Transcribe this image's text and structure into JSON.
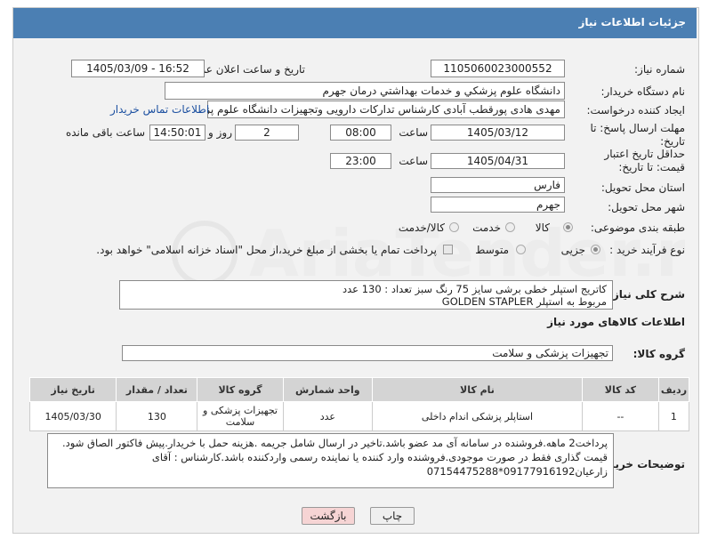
{
  "header": {
    "title": "جزئیات اطلاعات نیاز"
  },
  "form": {
    "need_number_label": "شماره نیاز:",
    "need_number": "1105060023000552",
    "announce_label": "تاریخ و ساعت اعلان عمومی:",
    "announce_value": "1405/03/09 - 16:52",
    "buyer_org_label": "نام دستگاه خریدار:",
    "buyer_org": "دانشگاه علوم پزشکي و خدمات بهداشتي  درمان جهرم",
    "creator_label": "ایجاد کننده درخواست:",
    "creator": "مهدی هادی پورقطب آبادی کارشناس تدارکات دارویی وتجهیزات دانشگاه علوم پز",
    "contact_link": "اطلاعات تماس خریدار",
    "deadline_label": "مهلت ارسال پاسخ: تا تاریخ:",
    "deadline_date": "1405/03/12",
    "time_label": "ساعت",
    "deadline_time": "08:00",
    "days_value": "2",
    "days_label": "روز و",
    "remaining_time": "14:50:01",
    "remaining_label": "ساعت باقی مانده",
    "validity_label": "حداقل تاریخ اعتبار قیمت: تا تاریخ:",
    "validity_date": "1405/04/31",
    "validity_time": "23:00",
    "province_label": "استان محل تحویل:",
    "province": "فارس",
    "city_label": "شهر محل تحویل:",
    "city": "جهرم",
    "category_label": "طبقه بندی موضوعی:",
    "category_options": [
      "کالا",
      "خدمت",
      "کالا/خدمت"
    ],
    "process_label": "نوع فرآیند خرید :",
    "process_options": [
      "جزیی",
      "متوسط"
    ],
    "payment_note": "پرداخت تمام یا بخشی از مبلغ خرید،از محل \"اسناد خزانه اسلامی\" خواهد بود."
  },
  "summary": {
    "label": "شرح کلی نیاز:",
    "line1": "کاتریج استپلر خطی برشی سایز 75 رنگ  سبز    تعداد : 130 عدد",
    "line2": "مربوط به استپلر  GOLDEN STAPLER"
  },
  "goods": {
    "section_title": "اطلاعات کالاهای مورد نیاز",
    "group_label": "گروه کالا:",
    "group_value": "تجهیزات پزشکی و سلامت",
    "columns": [
      "ردیف",
      "کد کالا",
      "نام کالا",
      "واحد شمارش",
      "گروه کالا",
      "تعداد / مقدار",
      "تاریخ نیاز"
    ],
    "rows": [
      [
        "1",
        "--",
        "استاپلر پزشکی اندام داخلی",
        "عدد",
        "تجهیزات پزشکی و سلامت",
        "130",
        "1405/03/30"
      ]
    ]
  },
  "buyer_notes": {
    "label": "توضیحات خریدار:",
    "text": "پرداخت2 ماهه.فروشنده در سامانه آی مد عضو باشد.تاخیر در ارسال شامل جریمه .هزینه حمل با خریدار.پیش فاکتور الصاق شود. قیمت گذاری فقط در صورت موجودی.فروشنده وارد کننده یا نماینده رسمی واردکننده باشد.کارشناس : آقای زارعیان09177916192*07154475288"
  },
  "buttons": {
    "print": "چاپ",
    "back": "بازگشت"
  },
  "colors": {
    "title_bar": "#4b7fb3",
    "table_header": "#d4d4d4",
    "back_button": "#f6d4d4"
  }
}
